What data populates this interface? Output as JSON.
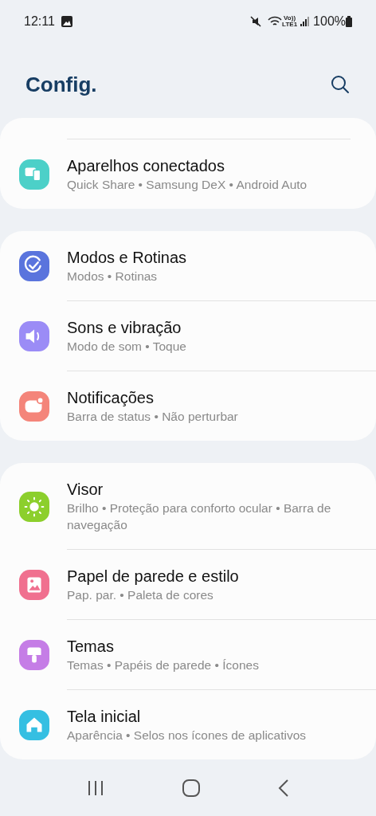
{
  "status_bar": {
    "time": "12:11",
    "network": "Vo))\nLTE1",
    "battery": "100%"
  },
  "header": {
    "title": "Config."
  },
  "groups": [
    {
      "items": [
        {
          "title": "Aparelhos conectados",
          "subtitle": "Quick Share • Samsung DeX • Android Auto",
          "color": "#4cd0c8"
        }
      ]
    },
    {
      "items": [
        {
          "title": "Modos e Rotinas",
          "subtitle": "Modos • Rotinas",
          "color": "#5a74dd"
        },
        {
          "title": "Sons e vibração",
          "subtitle": "Modo de som • Toque",
          "color": "#9b8cf6"
        },
        {
          "title": "Notificações",
          "subtitle": "Barra de status • Não perturbar",
          "color": "#f4857a"
        }
      ]
    },
    {
      "items": [
        {
          "title": "Visor",
          "subtitle": "Brilho • Proteção para conforto ocular • Barra de navegação",
          "color": "#8ccf2c"
        },
        {
          "title": "Papel de parede e estilo",
          "subtitle": "Pap. par. • Paleta de cores",
          "color": "#f0708f"
        },
        {
          "title": "Temas",
          "subtitle": "Temas • Papéis de parede • Ícones",
          "color": "#c57de6"
        },
        {
          "title": "Tela inicial",
          "subtitle": "Aparência • Selos nos ícones de aplicativos",
          "color": "#35bfe2"
        }
      ]
    }
  ]
}
